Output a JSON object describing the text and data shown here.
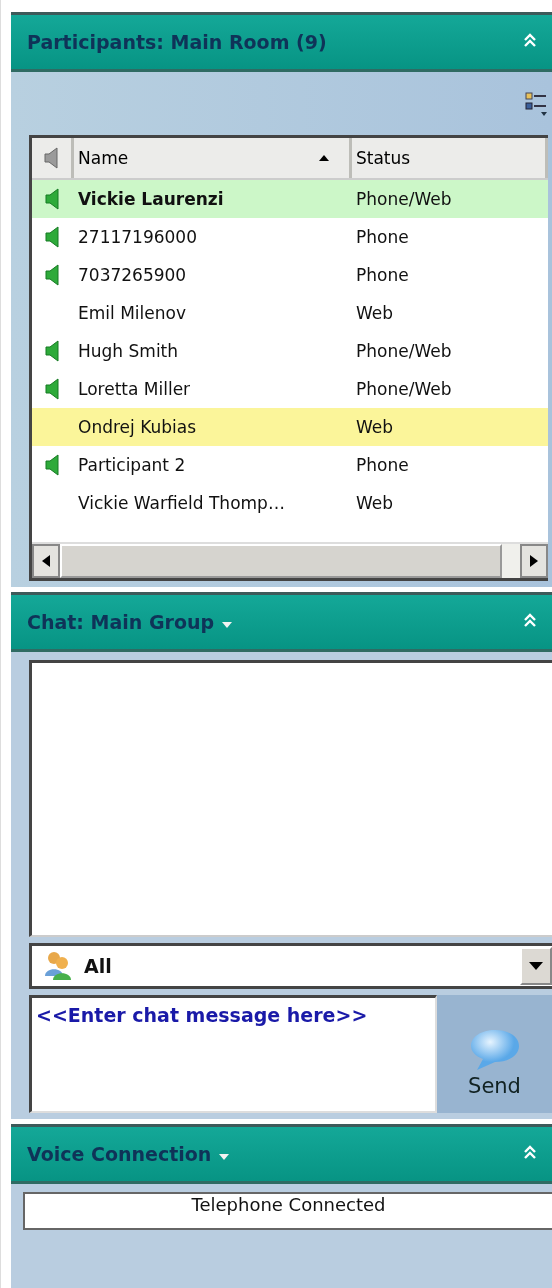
{
  "participants_panel": {
    "title": "Participants: Main Room (9)",
    "collapsed": false,
    "table": {
      "columns": [
        {
          "label": "Name",
          "sorted": true
        },
        {
          "label": "Status",
          "sorted": false
        }
      ],
      "rows": [
        {
          "name": "Vickie Laurenzi",
          "status": "Phone/Web",
          "audio": true,
          "speaking": true,
          "selected": false
        },
        {
          "name": "27117196000",
          "status": "Phone",
          "audio": true,
          "speaking": false,
          "selected": false
        },
        {
          "name": "7037265900",
          "status": "Phone",
          "audio": true,
          "speaking": false,
          "selected": false
        },
        {
          "name": "Emil Milenov",
          "status": "Web",
          "audio": false,
          "speaking": false,
          "selected": false
        },
        {
          "name": "Hugh Smith",
          "status": "Phone/Web",
          "audio": true,
          "speaking": false,
          "selected": false
        },
        {
          "name": "Loretta Miller",
          "status": "Phone/Web",
          "audio": true,
          "speaking": false,
          "selected": false
        },
        {
          "name": "Ondrej Kubias",
          "status": "Web",
          "audio": false,
          "speaking": false,
          "selected": true
        },
        {
          "name": "Participant 2",
          "status": "Phone",
          "audio": true,
          "speaking": false,
          "selected": false
        },
        {
          "name": "Vickie Warfield Thomp…",
          "status": "Web",
          "audio": false,
          "speaking": false,
          "selected": false
        }
      ]
    }
  },
  "chat_panel": {
    "title": "Chat: Main Group",
    "recipient": "All",
    "message_placeholder": "<<Enter chat message here>>",
    "send_button": "Send"
  },
  "voice_panel": {
    "title": "Voice Connection",
    "status": "Telephone Connected"
  }
}
